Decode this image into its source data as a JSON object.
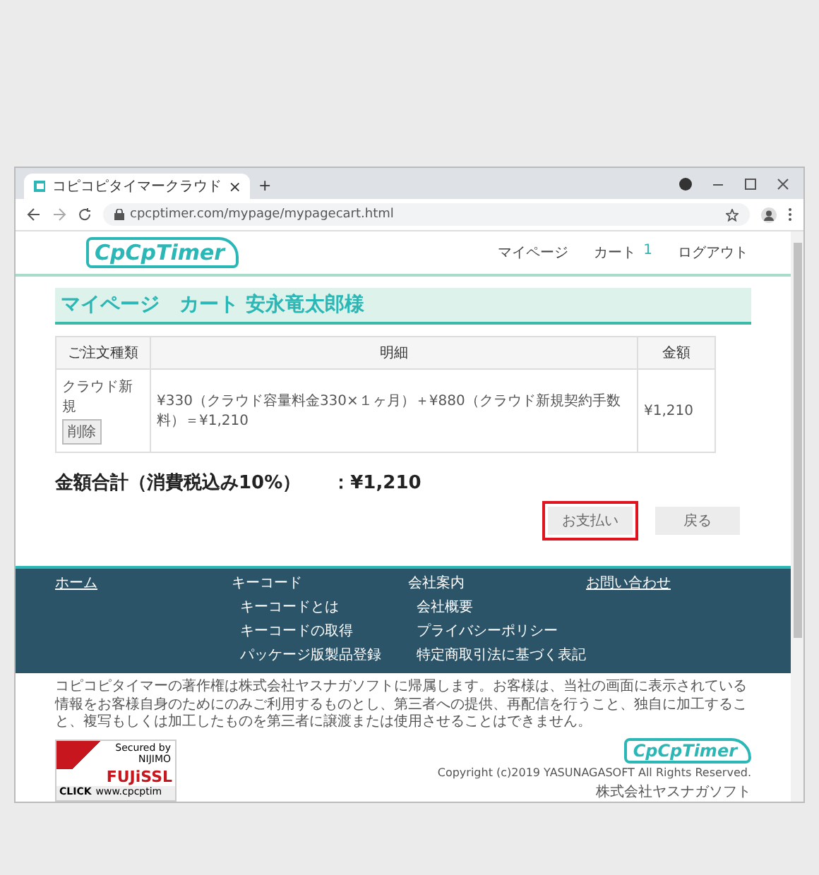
{
  "browser": {
    "tab_title": "コピコピタイマークラウド",
    "tab_close": "×",
    "new_tab": "+",
    "url": "cpcptimer.com/mypage/mypagecart.html"
  },
  "header": {
    "logo": "CpCpTimer",
    "nav": [
      {
        "label": "マイページ"
      },
      {
        "label": "カート",
        "count": "1"
      },
      {
        "label": "ログアウト"
      }
    ]
  },
  "page_title": "マイページ　カート 安永竜太郎様",
  "table": {
    "columns": [
      "ご注文種類",
      "明細",
      "金額"
    ],
    "rows": [
      {
        "type": "クラウド新規",
        "delete_button": "削除",
        "detail": "¥330（クラウド容量料金330×１ヶ月）＋¥880（クラウド新規契約手数料）＝¥1,210",
        "amount": "¥1,210"
      }
    ]
  },
  "total": {
    "label": "金額合計（消費税込み10%）",
    "value": "：¥1,210"
  },
  "buttons": [
    {
      "label": "お支払い",
      "highlighted": true
    },
    {
      "label": "戻る",
      "highlighted": false
    }
  ],
  "footer": {
    "columns": [
      {
        "heading": "ホーム",
        "underlined": true
      },
      {
        "heading": "キーコード",
        "underlined": false,
        "items": [
          "キーコードとは",
          "キーコードの取得",
          "パッケージ版製品登録"
        ]
      },
      {
        "heading": "会社案内",
        "underlined": false,
        "items": [
          "会社概要",
          "プライバシーポリシー",
          "特定商取引法に基づく表記"
        ]
      },
      {
        "heading": "お問い合わせ",
        "underlined": true
      }
    ]
  },
  "notice": "コピコピタイマーの著作権は株式会社ヤスナガソフトに帰属します。お客様は、当社の画面に表示されている情報をお客様自身のためにのみご利用するものとし、第三者への提供、再配信を行うこと、独自に加工すること、複写もしくは加工したものを第三者に譲渡または使用させることはできません。",
  "ssl_badge": {
    "secured": "Secured by",
    "brand": "NIJIMO",
    "name": "FUJiSSL",
    "click": "CLICK",
    "site": "www.cpcptim"
  },
  "bottom": {
    "logo": "CpCpTimer",
    "copyright": "Copyright (c)2019 YASUNAGASOFT All Rights Reserved.",
    "company": "株式会社ヤスナガソフト"
  }
}
